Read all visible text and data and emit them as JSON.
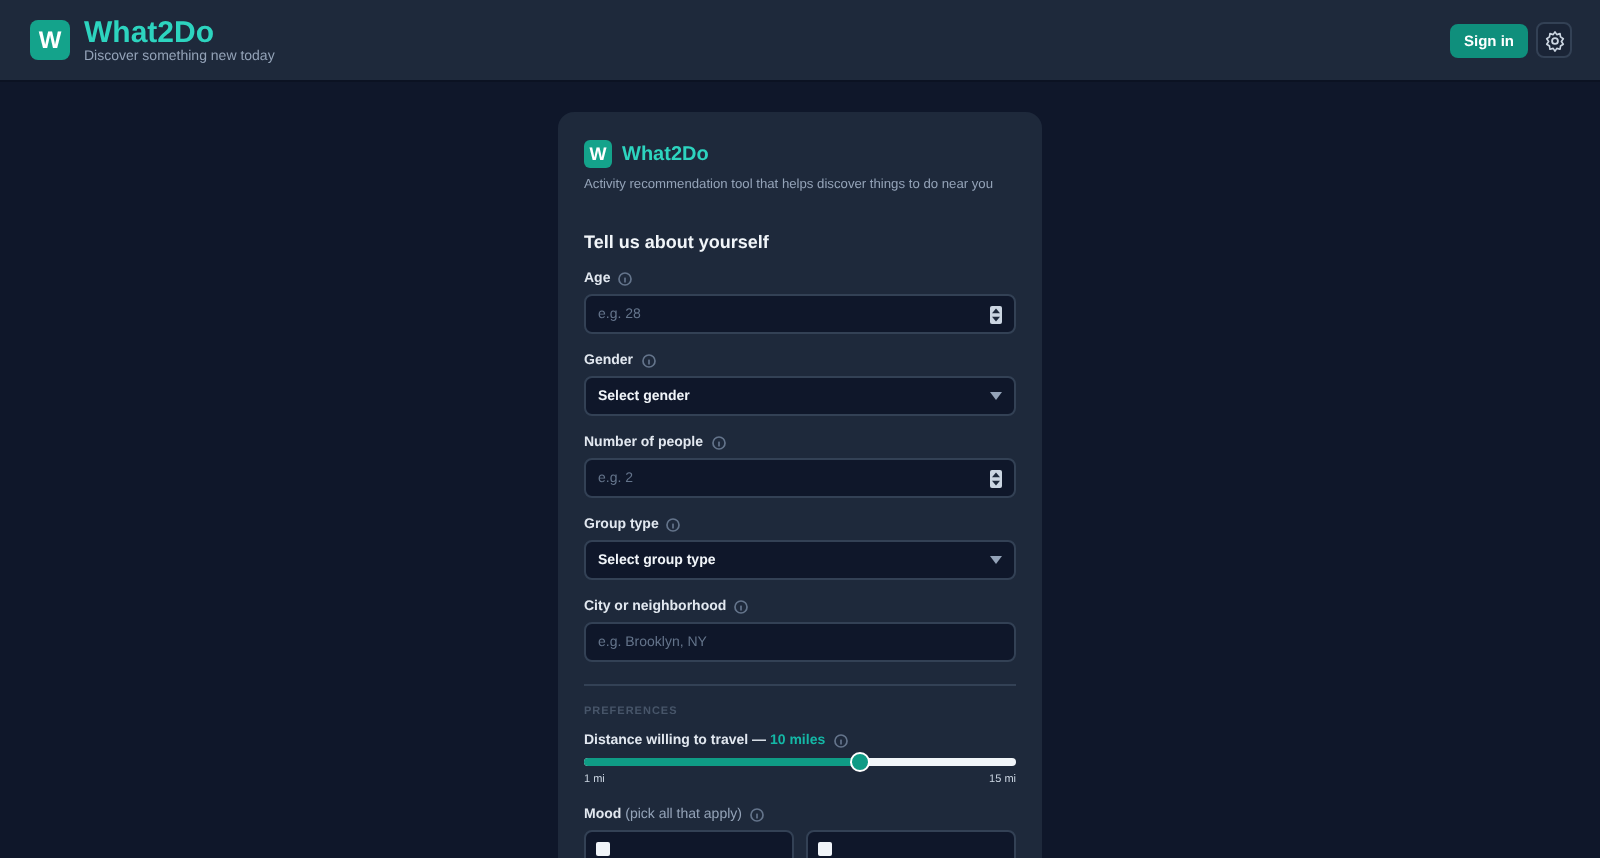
{
  "header": {
    "logo_letter": "W",
    "title": "What2Do",
    "subtitle": "Discover something new today",
    "sign_in": "Sign in"
  },
  "card": {
    "logo_letter": "W",
    "title": "What2Do",
    "description": "Activity recommendation tool that helps discover things to do near you",
    "heading": "Tell us about yourself",
    "fields": [
      {
        "kind": "number",
        "label": "Age",
        "placeholder": "e.g. 28"
      },
      {
        "kind": "select",
        "label": "Gender",
        "value": "Select gender"
      },
      {
        "kind": "number",
        "label": "Number of people",
        "placeholder": "e.g. 2"
      },
      {
        "kind": "select",
        "label": "Group type",
        "value": "Select group type"
      },
      {
        "kind": "text",
        "label": "City or neighborhood",
        "placeholder": "e.g. Brooklyn, NY"
      }
    ],
    "section": "PREFERENCES",
    "distance": {
      "label": "Distance willing to travel —",
      "value": "10 miles",
      "level": 0.64,
      "min": "1 mi",
      "max": "15 mi"
    },
    "mood": {
      "label": "Mood",
      "hint": "(pick all that apply)",
      "options": [
        {
          "checked": false
        },
        {
          "checked": false
        }
      ]
    }
  }
}
